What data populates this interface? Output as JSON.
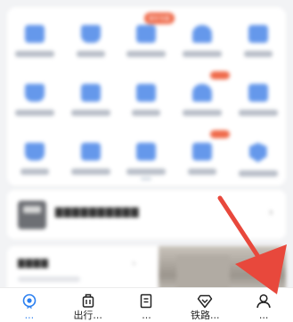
{
  "services": {
    "items": [
      {
        "icon": "calendar-icon",
        "badge": null
      },
      {
        "icon": "folder-icon",
        "badge": null
      },
      {
        "icon": "ticket-icon",
        "badge": "青年专属"
      },
      {
        "icon": "suitcase-icon",
        "badge": null
      },
      {
        "icon": "train-icon",
        "badge": null
      },
      {
        "icon": "mountain-icon",
        "badge": null
      },
      {
        "icon": "chart-icon",
        "badge": null
      },
      {
        "icon": "clipboard-icon",
        "badge": null
      },
      {
        "icon": "mail-icon",
        "badge": ""
      },
      {
        "icon": "person-icon",
        "badge": null
      },
      {
        "icon": "gift-icon",
        "badge": null
      },
      {
        "icon": "screen-icon",
        "badge": null
      },
      {
        "icon": "cart-icon",
        "badge": null
      },
      {
        "icon": "mail-icon",
        "badge": ""
      },
      {
        "icon": "shield-icon",
        "badge": null
      }
    ]
  },
  "tabbar": {
    "tabs": [
      {
        "label": "...",
        "icon": "home-icon",
        "active": true
      },
      {
        "label": "出行...",
        "icon": "luggage-icon",
        "active": false
      },
      {
        "label": "...",
        "icon": "document-icon",
        "active": false
      },
      {
        "label": "铁路...",
        "icon": "diamond-icon",
        "active": false
      },
      {
        "label": "...",
        "icon": "user-icon",
        "active": false
      }
    ]
  },
  "colors": {
    "accent": "#2a7ff0",
    "service_icon": "#4a86e8",
    "badge": "#ef6a4a",
    "annotation_arrow": "#e8483c"
  }
}
